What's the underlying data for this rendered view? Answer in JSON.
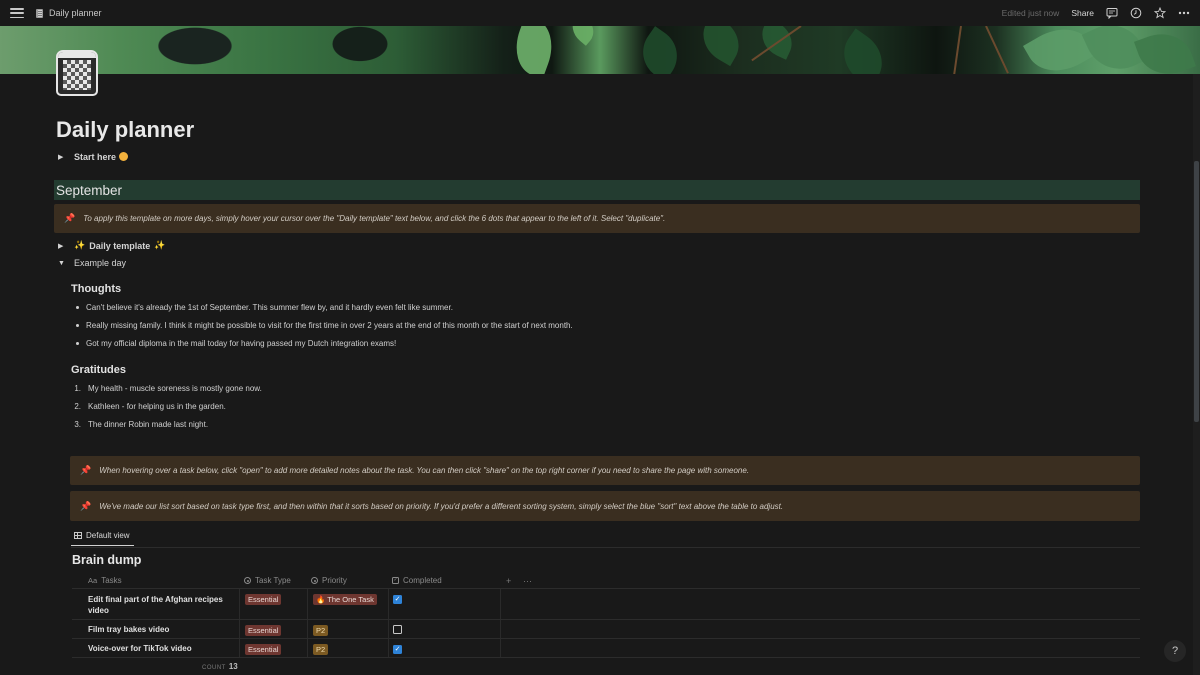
{
  "topbar": {
    "page_title": "Daily planner",
    "edited": "Edited just now",
    "share": "Share",
    "icons": [
      "menu-icon",
      "comments-icon",
      "history-icon",
      "favorite-star-icon",
      "more-icon"
    ]
  },
  "page": {
    "icon": "notebook-checker-icon",
    "title": "Daily planner",
    "start_here": "Start here",
    "month_heading": "September",
    "callout_1": "To apply this template on more days, simply hover your cursor over the \"Daily template\" text below, and click the 6 dots that appear to the left of it. Select \"duplicate\".",
    "daily_template": "Daily template",
    "example_day": "Example day"
  },
  "thoughts": {
    "heading": "Thoughts",
    "items": [
      "Can't believe it's already the 1st of September. This summer flew by, and it hardly even felt like summer.",
      "Really missing family. I think it might be possible to visit for the first time in over 2 years at the end of this month or the start of next month.",
      "Got my official diploma in the mail today for having passed my Dutch integration exams!"
    ]
  },
  "gratitudes": {
    "heading": "Gratitudes",
    "items": [
      {
        "num": "1.",
        "text": "My health - muscle soreness is mostly gone now."
      },
      {
        "num": "2.",
        "text": "Kathleen - for helping us in the garden."
      },
      {
        "num": "3.",
        "text": "The dinner Robin made last night."
      }
    ]
  },
  "callouts": {
    "open_tip": "When hovering over a task below, click \"open\" to add more detailed notes about the task. You can then click \"share\" on the top right corner if you need to share the page with someone.",
    "sort_tip": "We've made our list sort based on task type first, and then within that it sorts based on priority. If you'd prefer a different sorting system, simply select the blue \"sort\" text above the table to adjust."
  },
  "database": {
    "view_tab": "Default view",
    "title": "Brain dump",
    "columns": {
      "tasks_prefix": "Aa",
      "tasks": "Tasks",
      "task_type": "Task Type",
      "priority": "Priority",
      "completed": "Completed",
      "add": "+",
      "more": "···"
    },
    "rows": [
      {
        "task": "Edit final part of the Afghan recipes video",
        "task_type": "Essential",
        "priority": "The One Task",
        "priority_icon": "fire-icon",
        "completed": true
      },
      {
        "task": "Film tray bakes video",
        "task_type": "Essential",
        "priority": "P2",
        "completed": false
      },
      {
        "task": "Voice-over for TikTok video",
        "task_type": "Essential",
        "priority": "P2",
        "completed": true
      }
    ],
    "count_label": "COUNT",
    "count_value": "13"
  },
  "help": "?",
  "colors": {
    "background": "#191919",
    "heading_bg": "#233c30",
    "callout_bg": "#3a2e20",
    "essential_tag": "#6e3630",
    "p2_tag": "#7c5a22",
    "checkbox_on": "#2e83d8"
  }
}
